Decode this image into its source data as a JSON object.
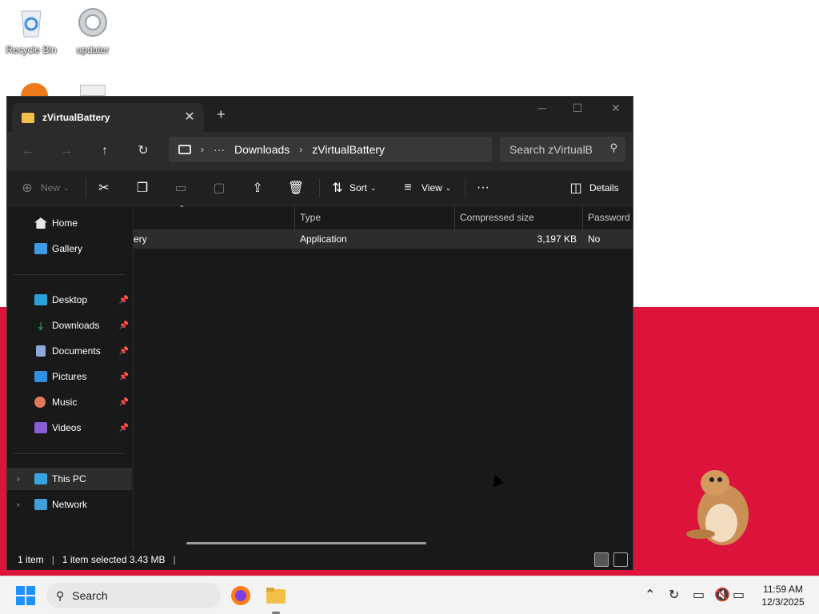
{
  "desktop": {
    "icons": [
      {
        "label": "Recycle Bin"
      },
      {
        "label": "updater"
      }
    ]
  },
  "window": {
    "tab_title": "zVirtualBattery",
    "breadcrumb": [
      "Downloads",
      "zVirtualBattery"
    ],
    "search_placeholder": "Search zVirtualB",
    "toolbar": {
      "new_label": "New",
      "sort_label": "Sort",
      "view_label": "View",
      "details_label": "Details"
    },
    "sidebar": {
      "top_items": [
        {
          "label": "Home",
          "icon": "home-icon"
        },
        {
          "label": "Gallery",
          "icon": "gallery-icon"
        }
      ],
      "pinned_items": [
        {
          "label": "Desktop",
          "icon": "desktop-icon"
        },
        {
          "label": "Downloads",
          "icon": "download-icon"
        },
        {
          "label": "Documents",
          "icon": "documents-icon"
        },
        {
          "label": "Pictures",
          "icon": "pictures-icon"
        },
        {
          "label": "Music",
          "icon": "music-icon"
        },
        {
          "label": "Videos",
          "icon": "videos-icon"
        }
      ],
      "bottom_items": [
        {
          "label": "This PC",
          "icon": "pc-icon"
        },
        {
          "label": "Network",
          "icon": "network-icon"
        }
      ]
    },
    "columns": {
      "type": "Type",
      "compressed_size": "Compressed size",
      "password": "Password p"
    },
    "rows": [
      {
        "name": "ery",
        "type": "Application",
        "compressed_size": "3,197 KB",
        "password": "No"
      }
    ],
    "status": {
      "item_count": "1 item",
      "selection": "1 item selected  3.43 MB"
    }
  },
  "taskbar": {
    "search_label": "Search",
    "time": "11:59 AM",
    "date": "12/3/2025"
  },
  "colors": {
    "wallpaper_bottom": "#dc143c",
    "window_bg": "#191919",
    "folder_accent": "#f2c04a"
  }
}
